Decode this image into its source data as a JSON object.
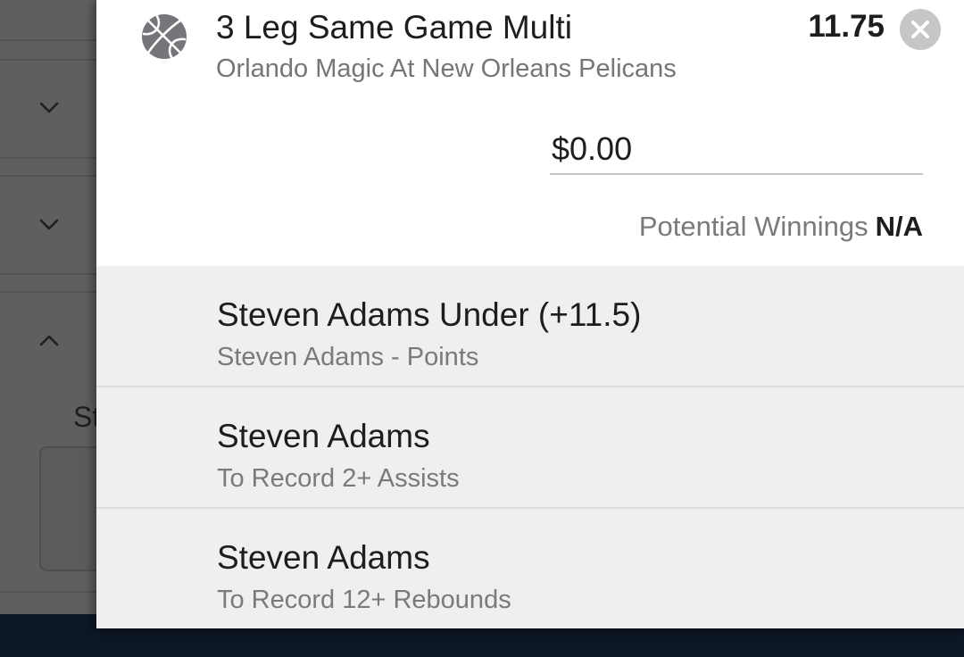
{
  "background": {
    "partial_text": "St",
    "chevrons": [
      {
        "icon": "chevron-down-icon"
      },
      {
        "icon": "chevron-down-icon"
      },
      {
        "icon": "chevron-up-icon"
      }
    ]
  },
  "bet": {
    "sport_icon": "basketball-icon",
    "title": "3 Leg Same Game Multi",
    "subtitle": "Orlando Magic At New Orleans Pelicans",
    "odds": "11.75",
    "close_icon": "close-icon",
    "stake": "$0.00",
    "potential_winnings_label": "Potential Winnings",
    "potential_winnings_value": "N/A"
  },
  "legs": [
    {
      "title": "Steven Adams Under (+11.5)",
      "subtitle": "Steven Adams - Points"
    },
    {
      "title": "Steven Adams",
      "subtitle": "To Record 2+ Assists"
    },
    {
      "title": "Steven Adams",
      "subtitle": "To Record 12+ Rebounds"
    }
  ],
  "colors": {
    "overlay": "#5e5f61",
    "sheet_background": "#ffffff",
    "legs_background": "#efeff1",
    "primary_text": "#1d1d1f",
    "secondary_text": "#7a7a7c",
    "close_button": "#c6c6c8",
    "footer": "#0d1726"
  }
}
